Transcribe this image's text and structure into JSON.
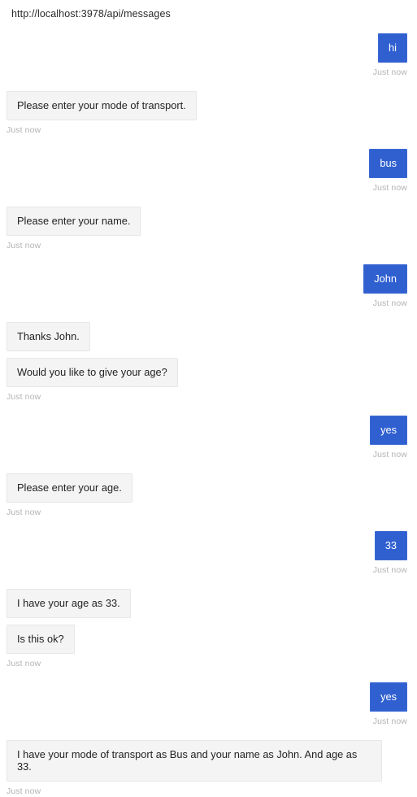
{
  "header": {
    "url": "http://localhost:3978/api/messages"
  },
  "conversation": {
    "timestamp_label": "Just now",
    "groups": [
      {
        "sender": "user",
        "bubbles": [
          "hi"
        ],
        "timestamp": "Just now"
      },
      {
        "sender": "bot",
        "bubbles": [
          "Please enter your mode of transport."
        ],
        "timestamp": "Just now"
      },
      {
        "sender": "user",
        "bubbles": [
          "bus"
        ],
        "timestamp": "Just now"
      },
      {
        "sender": "bot",
        "bubbles": [
          "Please enter your name."
        ],
        "timestamp": "Just now"
      },
      {
        "sender": "user",
        "bubbles": [
          "John"
        ],
        "timestamp": "Just now"
      },
      {
        "sender": "bot",
        "bubbles": [
          "Thanks John.",
          "Would you like to give your age?"
        ],
        "timestamp": "Just now"
      },
      {
        "sender": "user",
        "bubbles": [
          "yes"
        ],
        "timestamp": "Just now"
      },
      {
        "sender": "bot",
        "bubbles": [
          "Please enter your age."
        ],
        "timestamp": "Just now"
      },
      {
        "sender": "user",
        "bubbles": [
          "33"
        ],
        "timestamp": "Just now"
      },
      {
        "sender": "bot",
        "bubbles": [
          "I have your age as 33.",
          "Is this ok?"
        ],
        "timestamp": "Just now"
      },
      {
        "sender": "user",
        "bubbles": [
          "yes"
        ],
        "timestamp": "Just now"
      },
      {
        "sender": "bot",
        "bubbles": [
          "I have your mode of transport as Bus and your name as John. And age as 33."
        ],
        "timestamp": "Just now"
      }
    ]
  },
  "colors": {
    "user_bubble": "#3060d0",
    "user_text": "#ffffff",
    "bot_bubble": "#f4f4f4",
    "bot_border": "#e7e7e7",
    "bot_text": "#232323",
    "timestamp_text": "#b4b4b4",
    "page_background": "#ffffff"
  }
}
